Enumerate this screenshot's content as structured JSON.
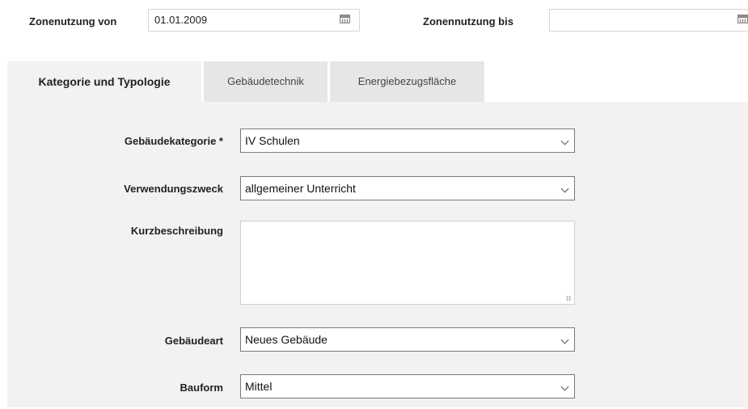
{
  "zone": {
    "from_label": "Zonenutzung von",
    "from_value": "01.01.2009",
    "to_label": "Zonennutzung bis",
    "to_value": ""
  },
  "tabs": [
    {
      "label": "Kategorie und Typologie",
      "active": true
    },
    {
      "label": "Gebäudetechnik",
      "active": false
    },
    {
      "label": "Energiebezugsfläche",
      "active": false
    }
  ],
  "form": {
    "kategorie_label": "Gebäudekategorie *",
    "kategorie_value": "IV Schulen",
    "zweck_label": "Verwendungszweck",
    "zweck_value": "allgemeiner Unterricht",
    "kurz_label": "Kurzbeschreibung",
    "kurz_value": "",
    "gebaeudeart_label": "Gebäudeart",
    "gebaeudeart_value": "Neues Gebäude",
    "bauform_label": "Bauform",
    "bauform_value": "Mittel"
  }
}
